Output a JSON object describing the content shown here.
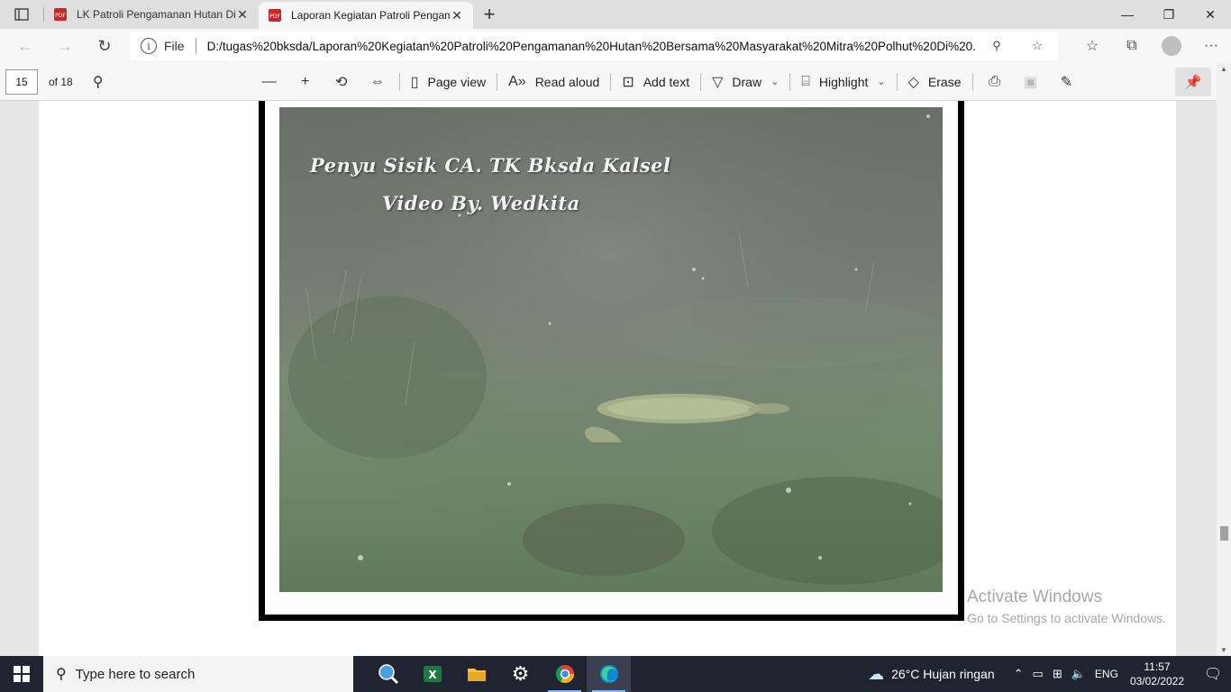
{
  "tabs": [
    {
      "title": "LK Patroli Pengamanan Hutan Di",
      "icon": "pdf-icon",
      "active": false
    },
    {
      "title": "Laporan Kegiatan Patroli Pengam",
      "icon": "pdf-icon",
      "active": true
    }
  ],
  "address": {
    "scheme_label": "File",
    "url": "D:/tugas%20bksda/Laporan%20Kegiatan%20Patroli%20Pengamanan%20Hutan%20Bersama%20Masyarakat%20Mitra%20Polhut%20Di%20..."
  },
  "pdf_toolbar": {
    "page_number": "15",
    "page_total": "of 18",
    "page_view": "Page view",
    "read_aloud": "Read aloud",
    "add_text": "Add text",
    "draw": "Draw",
    "highlight": "Highlight",
    "erase": "Erase"
  },
  "photo": {
    "caption_line1": "Penyu Sisik CA. TK Bksda Kalsel",
    "caption_line2": "Video By. Wedkita"
  },
  "watermark": {
    "line1": "Activate Windows",
    "line2": "Go to Settings to activate Windows."
  },
  "taskbar": {
    "search_placeholder": "Type here to search",
    "weather": "26°C  Hujan ringan",
    "language": "ENG",
    "time": "11:57",
    "date": "03/02/2022"
  },
  "colors": {
    "taskbar_bg": "#1f2430",
    "accent": "#0078d4"
  }
}
